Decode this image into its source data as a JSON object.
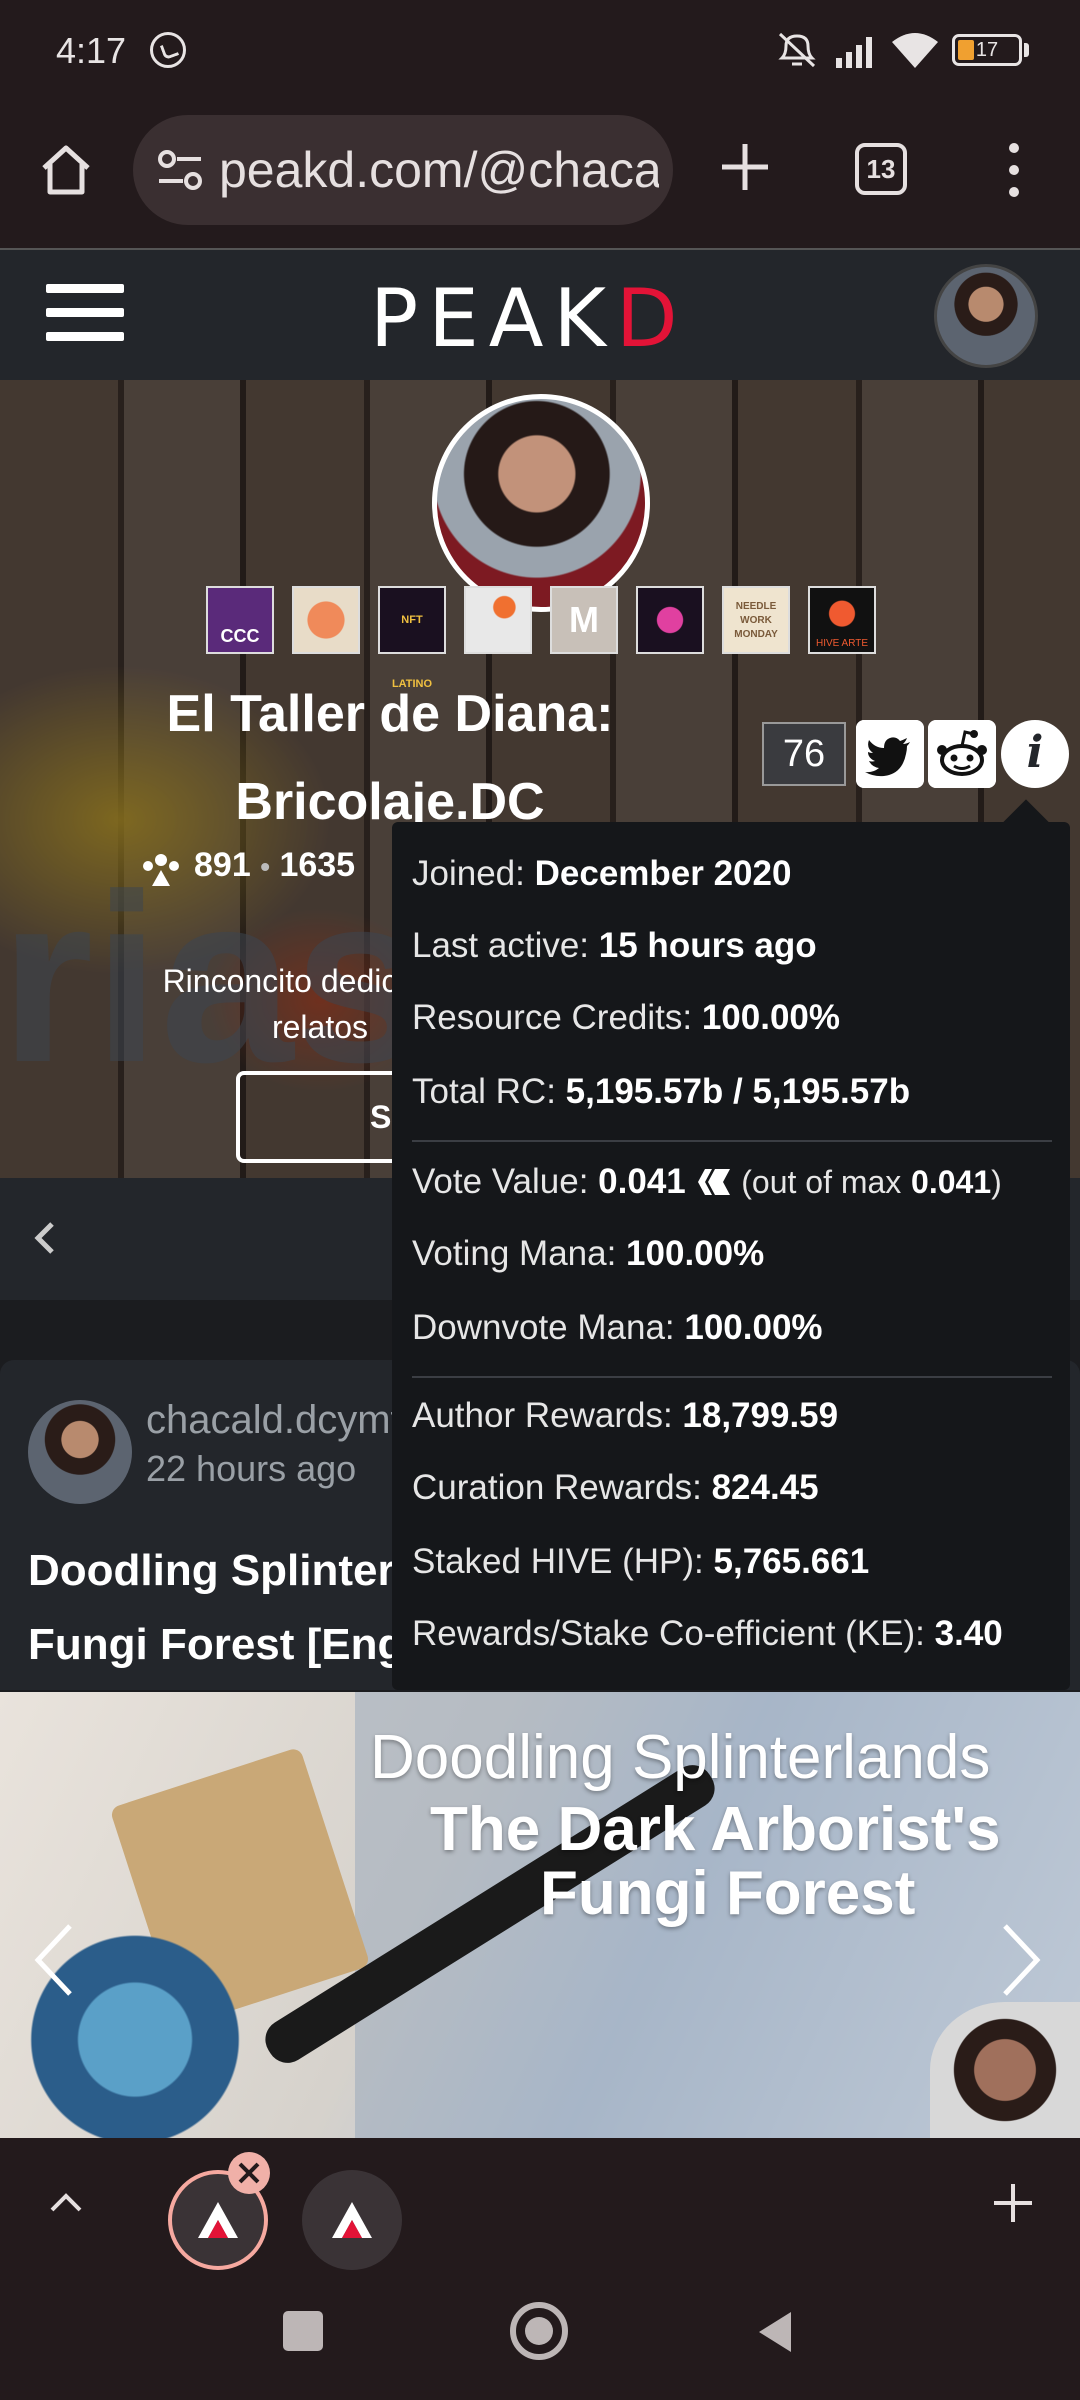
{
  "status_bar": {
    "time": "4:17",
    "battery_level": "17",
    "icons": [
      "whatsapp-icon",
      "mute-icon",
      "signal-icon",
      "wifi-icon",
      "battery-icon"
    ]
  },
  "browser": {
    "url": "peakd.com/@chacald.dcymt",
    "tab_count": "13",
    "icons": [
      "home-icon",
      "tune-icon",
      "plus-icon",
      "tabs-icon",
      "more-vert-icon"
    ]
  },
  "header": {
    "logo_left": "PE",
    "logo_a": "A",
    "logo_k": "K",
    "logo_d": "D"
  },
  "profile": {
    "name_line1": "El Taller de Diana:",
    "name_line2": "Bricolaje.DC",
    "followers": "891",
    "following": "1635",
    "separator": "•",
    "bio_line1": "Rinconcito dedicado a",
    "bio_line2": "relatos",
    "share_label": "Sh",
    "reputation": "76",
    "info_glyph": "i",
    "watermark": "rias",
    "badges": [
      "CCC",
      "d20",
      "NFT LATINO",
      "geo",
      "M",
      "hive",
      "NEEDLE WORK MONDAY",
      "HIVE ARTE"
    ]
  },
  "popover": {
    "joined_label": "Joined:",
    "joined_value": "December 2020",
    "last_active_label": "Last active:",
    "last_active_value": "15 hours ago",
    "rc_label": "Resource Credits:",
    "rc_value": "100.00%",
    "total_rc_label": "Total RC:",
    "total_rc_value": "5,195.57b / 5,195.57b",
    "vote_value_label": "Vote Value:",
    "vote_value": "0.041",
    "vote_max_prefix": "(out of max",
    "vote_max_value": "0.041",
    "vote_max_suffix": ")",
    "voting_mana_label": "Voting Mana:",
    "voting_mana_value": "100.00%",
    "downvote_mana_label": "Downvote Mana:",
    "downvote_mana_value": "100.00%",
    "author_rewards_label": "Author Rewards:",
    "author_rewards_value": "18,799.59",
    "curation_rewards_label": "Curation Rewards:",
    "curation_rewards_value": "824.45",
    "staked_label": "Staked HIVE (HP):",
    "staked_value": "5,765.661",
    "ke_label": "Rewards/Stake Co-efficient (KE):",
    "ke_value": "3.40"
  },
  "post": {
    "author": "chacald.dcymt",
    "time": "22 hours ago",
    "title_line1": "Doodling Splinterlands The Dark Arborist's",
    "title_line2": "Fungi Forest [English - Español]",
    "thumb_line1": "Doodling Splinterlands",
    "thumb_line2": "The Dark Arborist's",
    "thumb_line3": "Fungi Forest"
  },
  "colors": {
    "peakd_red": "#e31337",
    "page_bg": "#23262b",
    "popover_bg": "#15171a",
    "tab_accent": "#f6a9a0"
  }
}
